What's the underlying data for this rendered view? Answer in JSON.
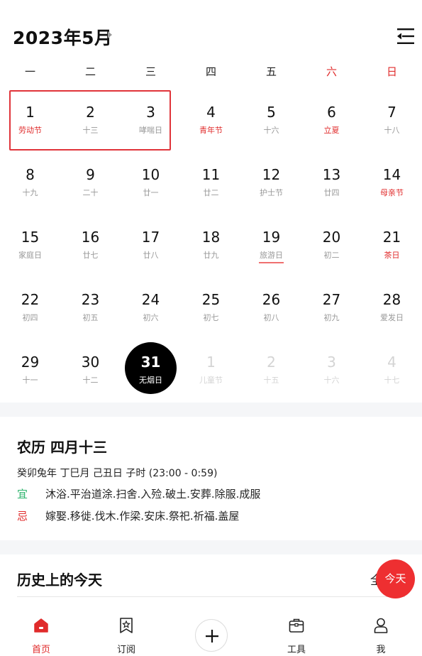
{
  "header": {
    "title": "2023年5月"
  },
  "weekdays": [
    "一",
    "二",
    "三",
    "四",
    "五",
    "六",
    "日"
  ],
  "calendar": {
    "rows": [
      [
        {
          "n": "1",
          "s": "劳动节"
        },
        {
          "n": "2",
          "s": "十三"
        },
        {
          "n": "3",
          "s": "哮喘日"
        },
        {
          "n": "4",
          "s": "青年节"
        },
        {
          "n": "5",
          "s": "十六"
        },
        {
          "n": "6",
          "s": "立夏"
        },
        {
          "n": "7",
          "s": "十八"
        }
      ],
      [
        {
          "n": "8",
          "s": "十九"
        },
        {
          "n": "9",
          "s": "二十"
        },
        {
          "n": "10",
          "s": "廿一"
        },
        {
          "n": "11",
          "s": "廿二"
        },
        {
          "n": "12",
          "s": "护士节"
        },
        {
          "n": "13",
          "s": "廿四"
        },
        {
          "n": "14",
          "s": "母亲节"
        }
      ],
      [
        {
          "n": "15",
          "s": "家庭日"
        },
        {
          "n": "16",
          "s": "廿七"
        },
        {
          "n": "17",
          "s": "廿八"
        },
        {
          "n": "18",
          "s": "廿九"
        },
        {
          "n": "19",
          "s": "旅游日"
        },
        {
          "n": "20",
          "s": "初二"
        },
        {
          "n": "21",
          "s": "茶日"
        }
      ],
      [
        {
          "n": "22",
          "s": "初四"
        },
        {
          "n": "23",
          "s": "初五"
        },
        {
          "n": "24",
          "s": "初六"
        },
        {
          "n": "25",
          "s": "初七"
        },
        {
          "n": "26",
          "s": "初八"
        },
        {
          "n": "27",
          "s": "初九"
        },
        {
          "n": "28",
          "s": "爱发日"
        }
      ],
      [
        {
          "n": "29",
          "s": "十一"
        },
        {
          "n": "30",
          "s": "十二"
        },
        {
          "n": "31",
          "s": "无烟日"
        },
        {
          "n": "1",
          "s": "儿童节"
        },
        {
          "n": "2",
          "s": "十五"
        },
        {
          "n": "3",
          "s": "十六"
        },
        {
          "n": "4",
          "s": "十七"
        }
      ]
    ]
  },
  "lunar": {
    "title": "农历 四月十三",
    "ganzhi": "癸卯兔年 丁巳月 己丑日 子时 (23:00 - 0:59)",
    "yi_label": "宜",
    "yi": "沐浴.平治道涂.扫舍.入殓.破土.安葬.除服.成服",
    "ji_label": "忌",
    "ji": "嫁娶.移徙.伐木.作梁.安床.祭祀.祈福.盖屋"
  },
  "history": {
    "title": "历史上的今天",
    "more": "全"
  },
  "today_button": "今天",
  "nav": {
    "home": "首页",
    "subscribe": "订阅",
    "tools": "工具",
    "me": "我"
  },
  "colors": {
    "accent": "#e02b2b",
    "yi": "#2bb36b",
    "today_bg": "#000000",
    "fab": "#ee2f31"
  }
}
